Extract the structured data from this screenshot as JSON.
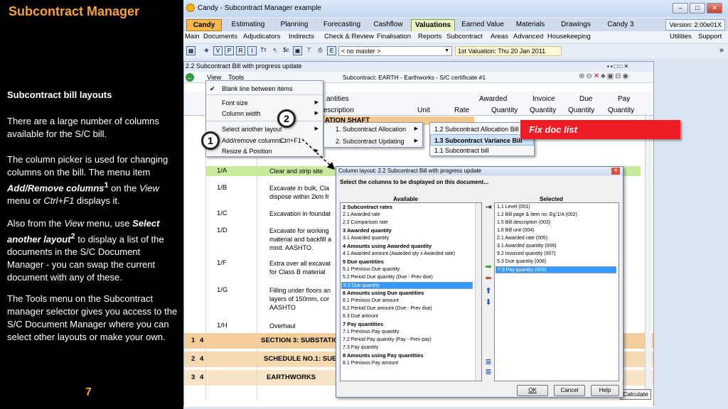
{
  "slide": {
    "title": "Subcontract Manager",
    "heading": "Subcontract bill layouts",
    "para1": "There are a large number of columns available for the S/C bill.",
    "para2_a": "The column picker is used for changing columns on the bill.  The menu item ",
    "para2_b": "Add/Remove columns",
    "para2_sup": "1",
    "para2_c": " on the ",
    "para2_d": "View",
    "para2_e": " menu or ",
    "para2_f": "Ctrl+F1",
    "para2_g": " displays it.",
    "para3_a": "Also from the ",
    "para3_b": "View",
    "para3_c": " menu, use ",
    "para3_d": "Select another layout",
    "para3_sup": "2",
    "para3_e": " to display a list of the documents in the S/C Document Manager - you can swap the current document with any of these.",
    "para4": "The Tools menu on the Subcontract manager selector gives you access to the S/C Document Manager where you can select other layouts or make your own.",
    "page_number": "7"
  },
  "app": {
    "window_title": "Candy - Subcontract Manager example",
    "version": "Version: 2.00e01X",
    "tabs": [
      "Candy",
      "Estimating",
      "Planning",
      "Forecasting",
      "Cashflow",
      "Valuations",
      "Earned Value",
      "Materials",
      "Drawings",
      "Candy 3"
    ],
    "menu": [
      "Main",
      "Documents",
      "Adjudicators",
      "Indirects",
      "Check & Review",
      "Finalisation",
      "Reports",
      "Subcontract",
      "Areas",
      "Advanced",
      "Housekeeping"
    ],
    "menu_right": [
      "Utilities",
      "Support"
    ],
    "master_select": "< no master >",
    "valuation": "1st Valuation: Thu 20 Jan 2011",
    "inner_title": "2.2 Subcontract Bill with progress update",
    "inner_menu": [
      "View",
      "Tools"
    ],
    "subcontract_label": "Subcontract: EARTH - Earthworks - S/C certificate #1",
    "headers": {
      "quantities": "antities",
      "description": "escription",
      "unit": "Unit",
      "awarded": "Awarded",
      "rate": "Rate",
      "quantity": "Quantity",
      "invoice": "Invoice",
      "invoice_q": "Quantity",
      "due": "Due",
      "due_q": "Quantity",
      "pay": "Pay",
      "pay_q": "Quantity"
    },
    "section_row": "ATION SHAFT",
    "rows": [
      {
        "code": "1/A",
        "desc": "Clear and strip site"
      },
      {
        "code": "1/B",
        "desc": "Excavate in bulk, Cla dispose within 2km fr"
      },
      {
        "code": "1/C",
        "desc": "Excavation in foundat"
      },
      {
        "code": "1/D",
        "desc": "Excavate for working material and backfill a mod. AASHTO."
      },
      {
        "code": "1/F",
        "desc": "Extra over all excavat for Class B material"
      },
      {
        "code": "1/G",
        "desc": "Filling under floors an layers of 150mm, cor AASHTO"
      },
      {
        "code": "1/H",
        "desc": "Overhaul"
      }
    ],
    "group_rows": [
      {
        "num": "1",
        "code": "4",
        "desc": "SECTION 3: SUBSTATIC"
      },
      {
        "num": "2",
        "code": "4",
        "desc": "SCHEDULE NO.1: SUE"
      },
      {
        "num": "3",
        "code": "4",
        "desc": "EARTHWORKS"
      }
    ],
    "calculate": "Calculate"
  },
  "view_menu": {
    "items": [
      {
        "label": "Blank line between items",
        "check": true
      },
      {
        "label": "Font size",
        "sub": true
      },
      {
        "label": "Column width",
        "sub": true
      },
      {
        "label": "Select another layout",
        "sub": true
      },
      {
        "label": "Add/remove columns..",
        "shortcut": "Ctrl+F1"
      },
      {
        "label": "Resize & Position",
        "sub": true
      }
    ]
  },
  "layout_menu": [
    "1. Subcontract Allocation",
    "2. Subcontract Updating"
  ],
  "layout_submenu": [
    "1.2 Subcontract Allocation Bill",
    "1.3 Subcontract Variance Bill",
    "1.1 Subcontract bill"
  ],
  "callout": "Fix doc list",
  "badges": [
    "1",
    "2"
  ],
  "dialog": {
    "title": "Column layout: 2.2 Subcontract Bill with progress update",
    "instruction": "Select the columns to be displayed on this document...",
    "available_label": "Available",
    "selected_label": "Selected",
    "available": [
      {
        "t": "2 Subcontract rates",
        "g": true
      },
      {
        "t": "2.1   Awarded rate"
      },
      {
        "t": "2.2   Comparison rate"
      },
      {
        "t": "3 Awarded quantity",
        "g": true
      },
      {
        "t": "3.1   Awarded quantity"
      },
      {
        "t": "4 Amounts using Awarded quantity",
        "g": true
      },
      {
        "t": "4.1   Awarded amount (Awarded qty x Awarded rate)"
      },
      {
        "t": "5 Due quantities",
        "g": true
      },
      {
        "t": "5.1   Previous Due quantity"
      },
      {
        "t": "5.2   Period Due quantity (Due - Prev due)"
      },
      {
        "t": "5.3   Due quantity",
        "s": true
      },
      {
        "t": "6 Amounts using Due quantities",
        "g": true
      },
      {
        "t": "6.1   Previous Due amount"
      },
      {
        "t": "6.2   Period Due amount (Due - Prev due)"
      },
      {
        "t": "6.3   Due amount"
      },
      {
        "t": "7 Pay quantities",
        "g": true
      },
      {
        "t": "7.1   Previous Pay quantity"
      },
      {
        "t": "7.2   Period Pay quantity (Pay - Prev pay)"
      },
      {
        "t": "7.3   Pay quantity"
      },
      {
        "t": "8 Amounts using Pay quantities",
        "g": true
      },
      {
        "t": "8.1   Previous Pay amount"
      }
    ],
    "selected": [
      {
        "t": "1.1    Level (001)"
      },
      {
        "t": "1.2    Bill page & item no. Eg:1/A (002)"
      },
      {
        "t": "1.5    Bill description (003)"
      },
      {
        "t": "1.6    Bill unit (004)"
      },
      {
        "t": "2.1    Awarded rate (005)"
      },
      {
        "t": "3.1    Awarded quantity (006)"
      },
      {
        "t": "9.2    Invoiced quantity (007)"
      },
      {
        "t": "5.3    Due quantity (008)"
      },
      {
        "t": "7.3    Pay quantity (009)",
        "s": true
      }
    ],
    "ok": "OK",
    "cancel": "Cancel",
    "help": "Help"
  },
  "colors": {
    "accent": "#f9a13a",
    "callout": "#ee1c24",
    "selection": "#3399ff",
    "valuations_tab": "#e9f3c4"
  }
}
